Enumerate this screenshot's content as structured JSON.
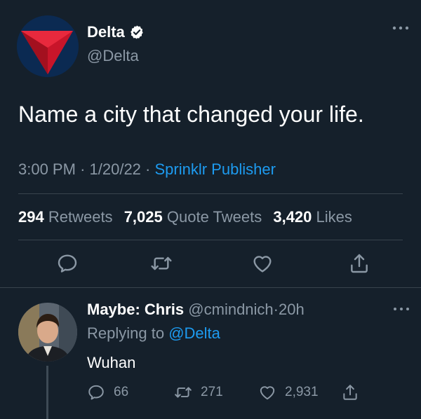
{
  "tweet": {
    "author_name": "Delta",
    "author_handle": "@Delta",
    "text": "Name a city that changed your life.",
    "time": "3:00 PM",
    "date": "1/20/22",
    "separator": "·",
    "source": "Sprinklr Publisher",
    "stats": {
      "retweets_count": "294",
      "retweets_label": "Retweets",
      "quotes_count": "7,025",
      "quotes_label": "Quote Tweets",
      "likes_count": "3,420",
      "likes_label": "Likes"
    }
  },
  "reply": {
    "author_name": "Maybe: Chris",
    "author_handle": "@cmindnich",
    "separator": "·",
    "age": "20h",
    "replying_prefix": "Replying to",
    "replying_mention": "@Delta",
    "text": "Wuhan",
    "counts": {
      "replies": "66",
      "retweets": "271",
      "likes": "2,931"
    }
  },
  "colors": {
    "background": "#15202b",
    "accent": "#1d9bf0",
    "muted": "#8b98a5",
    "divider": "#38444d",
    "brand_red": "#e01933"
  },
  "icons": {
    "verified": "verified-badge-icon",
    "more": "more-horizontal-icon",
    "reply": "reply-icon",
    "retweet": "retweet-icon",
    "like": "heart-icon",
    "share": "share-icon"
  }
}
